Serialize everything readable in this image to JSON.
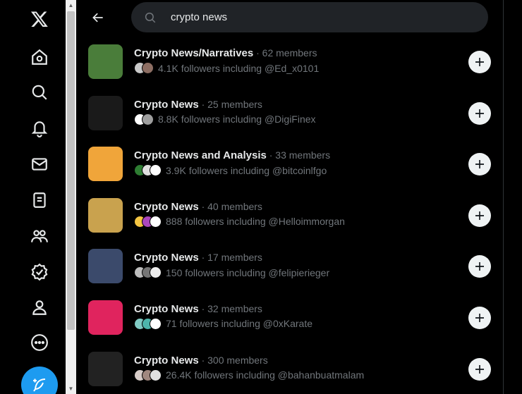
{
  "nav": {
    "items": [
      {
        "name": "x-logo-icon"
      },
      {
        "name": "home-icon"
      },
      {
        "name": "explore-icon"
      },
      {
        "name": "notifications-icon"
      },
      {
        "name": "messages-icon"
      },
      {
        "name": "lists-icon"
      },
      {
        "name": "communities-icon"
      },
      {
        "name": "verified-icon"
      },
      {
        "name": "profile-icon"
      },
      {
        "name": "more-icon"
      }
    ],
    "compose_icon": "compose-post-icon"
  },
  "search": {
    "value": "crypto news"
  },
  "results": [
    {
      "title": "Crypto News/Narratives",
      "members": " · 62 members",
      "followers": "4.1K followers including @Ed_x0101",
      "avatar_color": "#4a7d3a",
      "faces": [
        "#c9c9c9",
        "#8d6e63"
      ]
    },
    {
      "title": "Crypto News",
      "members": " · 25 members",
      "followers": "8.8K followers including @DigiFinex",
      "avatar_color": "#1a1a1a",
      "faces": [
        "#ffffff",
        "#9e9e9e"
      ]
    },
    {
      "title": "Crypto News and Analysis",
      "members": " · 33 members",
      "followers": "3.9K followers including @bitcoinlfgo",
      "avatar_color": "#f0a53a",
      "faces": [
        "#2e7d32",
        "#e0e0e0",
        "#ffffff"
      ]
    },
    {
      "title": "Crypto News",
      "members": " · 40 members",
      "followers": "888 followers including @Helloimmorgan",
      "avatar_color": "#c9a24e",
      "faces": [
        "#f4c542",
        "#ab47bc",
        "#ffffff"
      ]
    },
    {
      "title": "Crypto News",
      "members": " · 17 members",
      "followers": "150 followers including @felipierieger",
      "avatar_color": "#3b4a6b",
      "faces": [
        "#bdbdbd",
        "#757575",
        "#eeeeee"
      ]
    },
    {
      "title": "Crypto News",
      "members": " · 32 members",
      "followers": "71 followers including @0xKarate",
      "avatar_color": "#e0245e",
      "faces": [
        "#80cbc4",
        "#4db6ac",
        "#ffffff"
      ]
    },
    {
      "title": "Crypto News",
      "members": " · 300 members",
      "followers": "26.4K followers including @bahanbuatmalam",
      "avatar_color": "#222222",
      "faces": [
        "#d7ccc8",
        "#a1887f",
        "#e0e0e0"
      ]
    }
  ]
}
